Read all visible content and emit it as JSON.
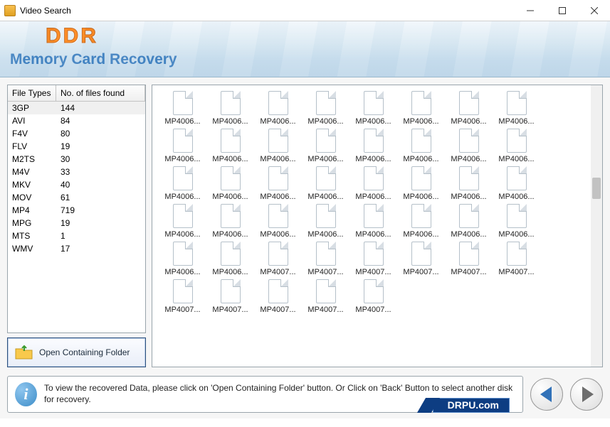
{
  "window": {
    "title": "Video Search",
    "brand_top": "DDR",
    "brand_sub": "Memory Card Recovery"
  },
  "filetypes": {
    "headers": {
      "col1": "File Types",
      "col2": "No. of files found"
    },
    "rows": [
      {
        "type": "3GP",
        "count": "144",
        "selected": true
      },
      {
        "type": "AVI",
        "count": "84"
      },
      {
        "type": "F4V",
        "count": "80"
      },
      {
        "type": "FLV",
        "count": "19"
      },
      {
        "type": "M2TS",
        "count": "30"
      },
      {
        "type": "M4V",
        "count": "33"
      },
      {
        "type": "MKV",
        "count": "40"
      },
      {
        "type": "MOV",
        "count": "61"
      },
      {
        "type": "MP4",
        "count": "719"
      },
      {
        "type": "MPG",
        "count": "19"
      },
      {
        "type": "MTS",
        "count": "1"
      },
      {
        "type": "WMV",
        "count": "17"
      }
    ]
  },
  "open_button": {
    "label": "Open Containing Folder"
  },
  "files": [
    "MP4006...",
    "MP4006...",
    "MP4006...",
    "MP4006...",
    "MP4006...",
    "MP4006...",
    "MP4006...",
    "MP4006...",
    "MP4006...",
    "MP4006...",
    "MP4006...",
    "MP4006...",
    "MP4006...",
    "MP4006...",
    "MP4006...",
    "MP4006...",
    "MP4006...",
    "MP4006...",
    "MP4006...",
    "MP4006...",
    "MP4006...",
    "MP4006...",
    "MP4006...",
    "MP4006...",
    "MP4006...",
    "MP4006...",
    "MP4006...",
    "MP4006...",
    "MP4006...",
    "MP4006...",
    "MP4006...",
    "MP4006...",
    "MP4006...",
    "MP4006...",
    "MP4007...",
    "MP4007...",
    "MP4007...",
    "MP4007...",
    "MP4007...",
    "MP4007...",
    "MP4007...",
    "MP4007...",
    "MP4007...",
    "MP4007...",
    "MP4007..."
  ],
  "footer": {
    "info": "To view the recovered Data, please click on 'Open Containing Folder' button. Or Click on 'Back' Button to select another disk for recovery.",
    "drpu": "DRPU.com"
  }
}
